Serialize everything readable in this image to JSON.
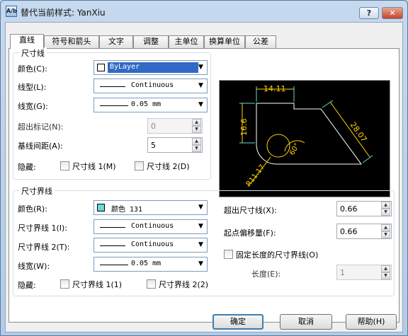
{
  "window": {
    "title": "替代当前样式: YanXiu",
    "icon_text": "A/b",
    "help_glyph": "?",
    "close_glyph": "✕"
  },
  "tabs": [
    {
      "label": "直线",
      "active": true
    },
    {
      "label": "符号和箭头"
    },
    {
      "label": "文字"
    },
    {
      "label": "调整"
    },
    {
      "label": "主单位"
    },
    {
      "label": "换算单位"
    },
    {
      "label": "公差"
    }
  ],
  "dim_line": {
    "legend": "尺寸线",
    "color_label": "颜色(C):",
    "color_value": "ByLayer",
    "linetype_label": "线型(L):",
    "linetype_value": "Continuous",
    "lineweight_label": "线宽(G):",
    "lineweight_value": "0.05 mm",
    "extend_label": "超出标记(N):",
    "extend_value": "0",
    "baseline_label": "基线间距(A):",
    "baseline_value": "5",
    "suppress_label": "隐藏:",
    "suppress_1": "尺寸线 1(M)",
    "suppress_2": "尺寸线 2(D)"
  },
  "ext_line": {
    "legend": "尺寸界线",
    "color_label": "颜色(R):",
    "color_value": "颜色 131",
    "color_hex": "#66d9d9",
    "lt1_label": "尺寸界线 1(I):",
    "lt1_value": "Continuous",
    "lt2_label": "尺寸界线 2(T):",
    "lt2_value": "Continuous",
    "lineweight_label": "线宽(W):",
    "lineweight_value": "0.05 mm",
    "suppress_label": "隐藏:",
    "suppress_1": "尺寸界线 1(1)",
    "suppress_2": "尺寸界线 2(2)",
    "beyond_label": "超出尺寸线(X):",
    "beyond_value": "0.66",
    "offset_label": "起点偏移量(F):",
    "offset_value": "0.66",
    "fixed_label": "固定长度的尺寸界线(O)",
    "length_label": "长度(E):",
    "length_value": "1"
  },
  "preview": {
    "dim_top": "14.11",
    "dim_left": "16.6",
    "dim_slant": "28.07",
    "dim_angle": "60°",
    "dim_radius": "R11.17"
  },
  "buttons": {
    "ok": "确定",
    "cancel": "取消",
    "help": "帮助(H)"
  },
  "colors": {
    "accent": "#316ac5",
    "preview_bg": "#000000",
    "dim_text": "#ffd400",
    "ext_line": "#66d9d9",
    "geometry": "#ffffff"
  }
}
